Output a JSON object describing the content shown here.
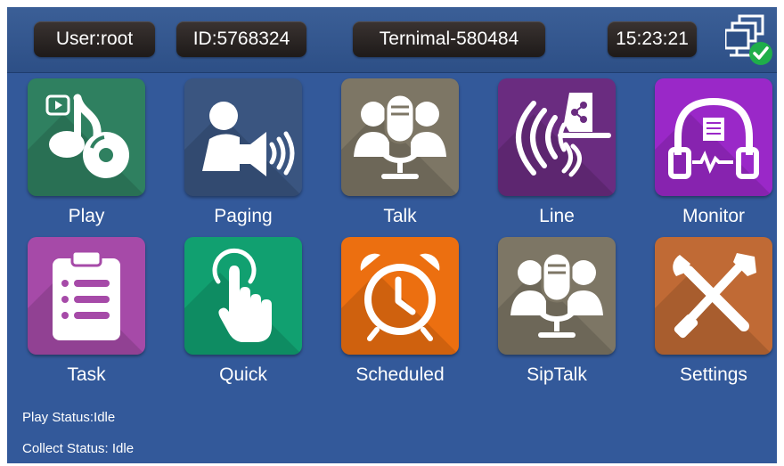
{
  "header": {
    "user": "User:root",
    "id": "ID:5768324",
    "terminal": "Ternimal-580484",
    "time": "15:23:21",
    "network_icon": "network-connected-icon"
  },
  "apps": [
    {
      "label": "Play",
      "icon": "music-disc-icon",
      "color": "#2f8060"
    },
    {
      "label": "Paging",
      "icon": "person-speaker-icon",
      "color": "#3a5580"
    },
    {
      "label": "Talk",
      "icon": "microphone-people-icon",
      "color": "#7d7665"
    },
    {
      "label": "Line",
      "icon": "line-broadcast-icon",
      "color": "#6a2c80"
    },
    {
      "label": "Monitor",
      "icon": "headphone-monitor-icon",
      "color": "#9a28c8"
    },
    {
      "label": "Task",
      "icon": "clipboard-list-icon",
      "color": "#a64aa8"
    },
    {
      "label": "Quick",
      "icon": "touch-hand-icon",
      "color": "#11a070"
    },
    {
      "label": "Scheduled",
      "icon": "alarm-clock-icon",
      "color": "#ec6f10"
    },
    {
      "label": "SipTalk",
      "icon": "microphone-people-icon",
      "color": "#7d7665"
    },
    {
      "label": "Settings",
      "icon": "tools-icon",
      "color": "#c06a35"
    }
  ],
  "status": {
    "play": "Play Status:Idle",
    "collect": "Collect Status: Idle"
  }
}
